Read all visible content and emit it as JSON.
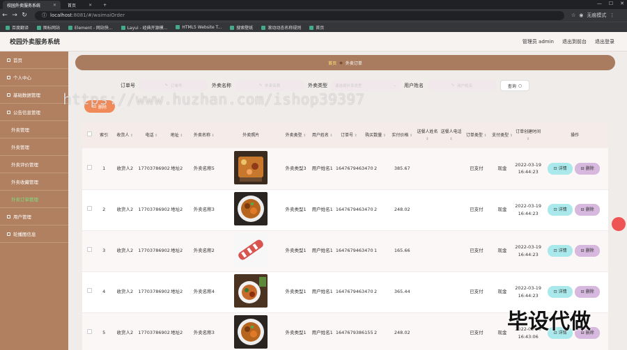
{
  "browser": {
    "tabs": [
      {
        "label": "校园外卖服务系统",
        "active": true
      },
      {
        "label": "首页",
        "active": false
      }
    ],
    "url_host": "localhost",
    "url_rest": ":8081/#/waimaiOrder",
    "incognito_label": "无痕模式",
    "bookmarks": [
      "百度翻译",
      "图标网站",
      "Element - 网站快...",
      "Layui - 经典开源模...",
      "HTML5 Website T...",
      "搜索壁纸",
      "滚动动态名称规则",
      "首页"
    ]
  },
  "header": {
    "title": "校园外卖服务系统",
    "admin_label": "管理员 admin",
    "back_label": "退出到前台",
    "logout_label": "退出登录"
  },
  "sidebar": {
    "items": [
      {
        "label": "首页",
        "sub": false,
        "active": false
      },
      {
        "label": "个人中心",
        "sub": false,
        "active": false
      },
      {
        "label": "基础数据管理",
        "sub": false,
        "active": false
      },
      {
        "label": "公告信息管理",
        "sub": false,
        "active": false
      },
      {
        "label": "外卖管理",
        "sub": true,
        "active": false
      },
      {
        "label": "外卖管理",
        "sub": true,
        "active": false
      },
      {
        "label": "外卖评价管理",
        "sub": true,
        "active": false
      },
      {
        "label": "外卖收藏管理",
        "sub": true,
        "active": false
      },
      {
        "label": "外卖订单管理",
        "sub": true,
        "active": true
      },
      {
        "label": "用户管理",
        "sub": false,
        "active": false
      },
      {
        "label": "轮播图信息",
        "sub": false,
        "active": false
      }
    ]
  },
  "breadcrumb": {
    "home": "首页",
    "current": "外卖订单"
  },
  "filters": {
    "order_no_label": "订单号",
    "order_no_placeholder": "订单号",
    "name_label": "外卖名称",
    "name_placeholder": "外卖名称",
    "type_label": "外卖类型",
    "type_placeholder": "请选择外卖类型",
    "user_label": "用户姓名",
    "user_placeholder": "用户姓名",
    "search_label": "查询"
  },
  "delete_button": "删除",
  "table": {
    "headers": [
      "索引",
      "收货人",
      "电话",
      "地址",
      "外卖名称",
      "外卖照片",
      "外卖类型",
      "用户姓名",
      "订单号",
      "购买数量",
      "实付价格",
      "送餐人姓名",
      "送餐人电话",
      "订单类型",
      "支付类型",
      "订单创建时间",
      "操作"
    ],
    "detail_label": "详情",
    "remove_label": "删除",
    "rows": [
      {
        "idx": "1",
        "receiver": "收货人2",
        "phone": "17703786902",
        "address": "地址2",
        "name": "外卖名称5",
        "type": "外卖类型3",
        "user": "用户姓名1",
        "order_no": "1647679463470",
        "qty": "2",
        "price": "385.67",
        "courier": "",
        "courier_phone": "",
        "order_type": "已支付",
        "pay_type": "现金",
        "created": "2022-03-19 16:44:23",
        "photo": "food1"
      },
      {
        "idx": "2",
        "receiver": "收货人2",
        "phone": "17703786902",
        "address": "地址2",
        "name": "外卖名称3",
        "type": "外卖类型1",
        "user": "用户姓名1",
        "order_no": "1647679463470",
        "qty": "2",
        "price": "248.02",
        "courier": "",
        "courier_phone": "",
        "order_type": "已支付",
        "pay_type": "现金",
        "created": "2022-03-19 16:44:23",
        "photo": "food2"
      },
      {
        "idx": "3",
        "receiver": "收货人2",
        "phone": "17703786902",
        "address": "地址2",
        "name": "外卖名称2",
        "type": "外卖类型1",
        "user": "用户姓名1",
        "order_no": "1647679463470",
        "qty": "1",
        "price": "165.66",
        "courier": "",
        "courier_phone": "",
        "order_type": "已支付",
        "pay_type": "现金",
        "created": "2022-03-19 16:44:23",
        "photo": "food3"
      },
      {
        "idx": "4",
        "receiver": "收货人2",
        "phone": "17703786902",
        "address": "地址2",
        "name": "外卖名称4",
        "type": "外卖类型1",
        "user": "用户姓名1",
        "order_no": "1647679463470",
        "qty": "2",
        "price": "365.44",
        "courier": "",
        "courier_phone": "",
        "order_type": "已支付",
        "pay_type": "现金",
        "created": "2022-03-19 16:44:23",
        "photo": "food4"
      },
      {
        "idx": "5",
        "receiver": "收货人2",
        "phone": "17703786902",
        "address": "地址2",
        "name": "外卖名称3",
        "type": "外卖类型1",
        "user": "用户姓名1",
        "order_no": "1647679386155",
        "qty": "2",
        "price": "248.02",
        "courier": "",
        "courier_phone": "",
        "order_type": "已支付",
        "pay_type": "现金",
        "created": "2022-03-19 16:43:06",
        "photo": "food2"
      }
    ]
  },
  "watermark": "https://www.huzhan.com/ishop39397",
  "corner_text": "毕设代做"
}
